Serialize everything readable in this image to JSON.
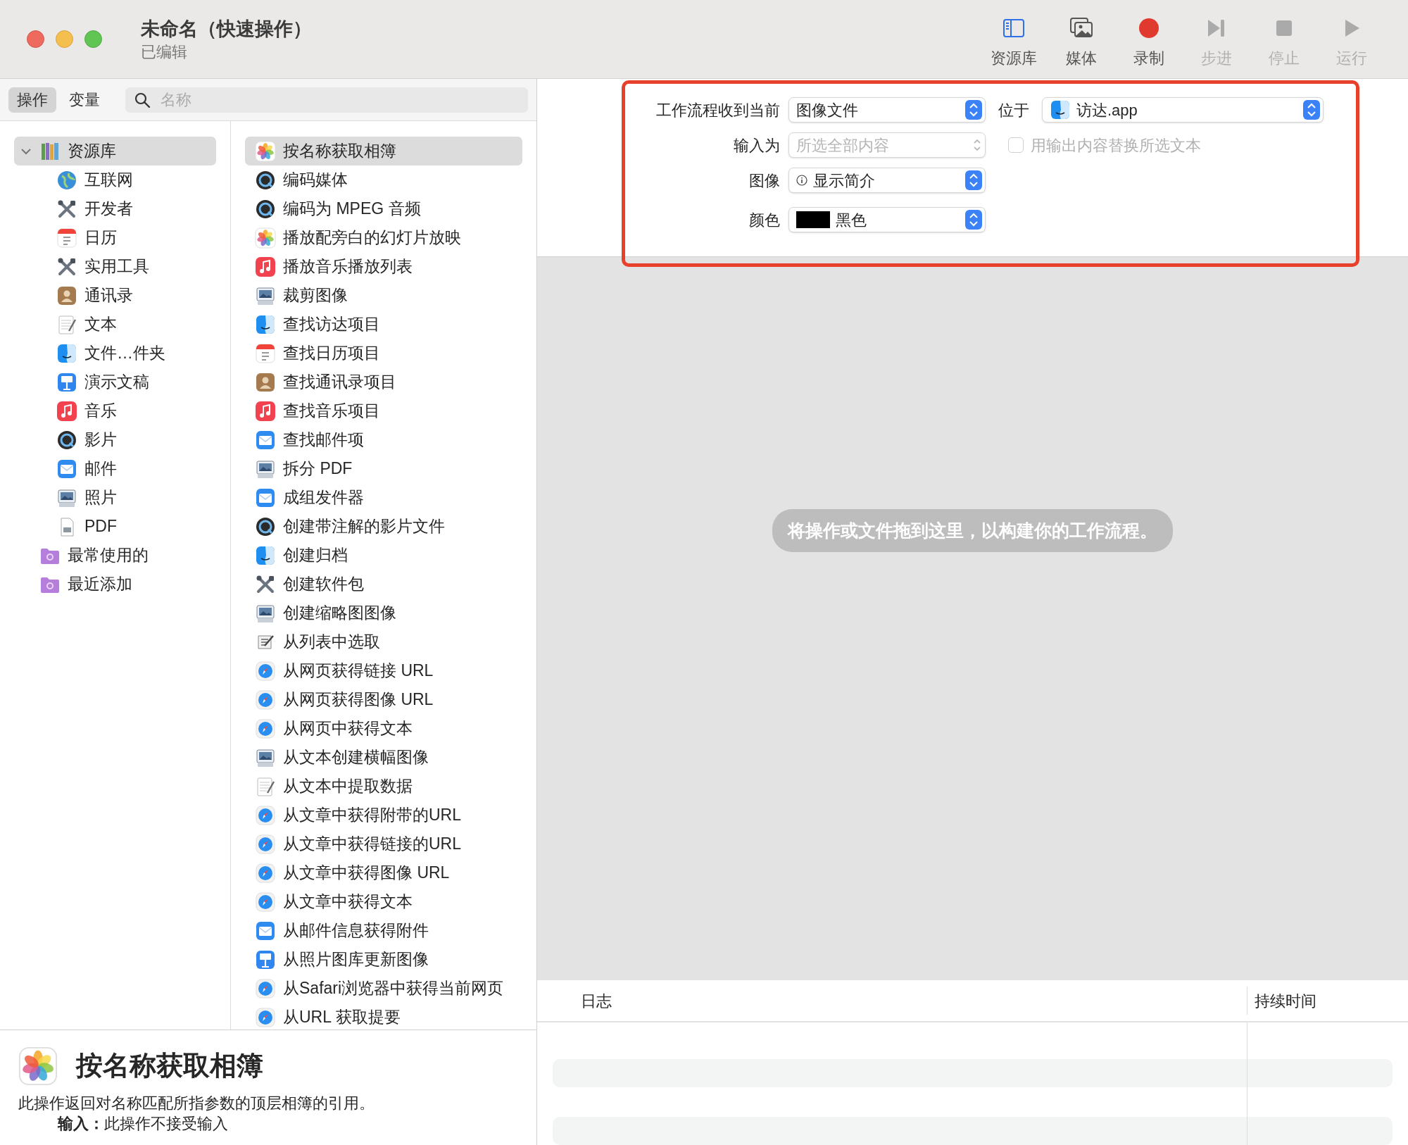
{
  "window": {
    "title": "未命名（快速操作）",
    "subtitle": "已编辑"
  },
  "toolbar": [
    {
      "label": "资源库",
      "kind": "library",
      "selected": true,
      "disabled": false
    },
    {
      "label": "媒体",
      "kind": "media",
      "selected": false,
      "disabled": false
    },
    {
      "label": "录制",
      "kind": "record",
      "disabled": false
    },
    {
      "label": "步进",
      "kind": "step",
      "disabled": true
    },
    {
      "label": "停止",
      "kind": "stop",
      "disabled": true
    },
    {
      "label": "运行",
      "kind": "run",
      "disabled": true
    }
  ],
  "library_tabs": [
    {
      "label": "操作",
      "selected": true
    },
    {
      "label": "变量",
      "selected": false
    }
  ],
  "search": {
    "placeholder": "名称"
  },
  "categories": [
    {
      "label": "资源库",
      "kind": "library",
      "expanded": true,
      "selected": true,
      "children": [
        {
          "label": "互联网",
          "kind": "globe",
          "selected": false
        },
        {
          "label": "开发者",
          "kind": "tools",
          "selected": false
        },
        {
          "label": "日历",
          "kind": "calendar",
          "selected": false
        },
        {
          "label": "实用工具",
          "kind": "tools",
          "selected": false
        },
        {
          "label": "通讯录",
          "kind": "contacts",
          "selected": false
        },
        {
          "label": "文本",
          "kind": "textedit",
          "selected": false
        },
        {
          "label": "文件…件夹",
          "kind": "finder",
          "selected": false
        },
        {
          "label": "演示文稿",
          "kind": "keynote",
          "selected": false
        },
        {
          "label": "音乐",
          "kind": "music",
          "selected": false
        },
        {
          "label": "影片",
          "kind": "quicktime",
          "selected": false
        },
        {
          "label": "邮件",
          "kind": "mail",
          "selected": false
        },
        {
          "label": "照片",
          "kind": "preview",
          "selected": false
        },
        {
          "label": "PDF",
          "kind": "pdf",
          "selected": false
        }
      ]
    },
    {
      "label": "最常使用的",
      "kind": "folder",
      "selected": false
    },
    {
      "label": "最近添加",
      "kind": "folder",
      "selected": false
    }
  ],
  "actions": [
    {
      "label": "按名称获取相簿",
      "kind": "photos",
      "selected": true
    },
    {
      "label": "编码媒体",
      "kind": "quicktime",
      "selected": false
    },
    {
      "label": "编码为 MPEG 音频",
      "kind": "quicktime",
      "selected": false
    },
    {
      "label": "播放配旁白的幻灯片放映",
      "kind": "photos",
      "selected": false
    },
    {
      "label": "播放音乐播放列表",
      "kind": "music",
      "selected": false
    },
    {
      "label": "裁剪图像",
      "kind": "preview",
      "selected": false
    },
    {
      "label": "查找访达项目",
      "kind": "finder",
      "selected": false
    },
    {
      "label": "查找日历项目",
      "kind": "calendar",
      "selected": false
    },
    {
      "label": "查找通讯录项目",
      "kind": "contacts",
      "selected": false
    },
    {
      "label": "查找音乐项目",
      "kind": "music",
      "selected": false
    },
    {
      "label": "查找邮件项",
      "kind": "mail",
      "selected": false
    },
    {
      "label": "拆分 PDF",
      "kind": "preview",
      "selected": false
    },
    {
      "label": "成组发件器",
      "kind": "mail",
      "selected": false
    },
    {
      "label": "创建带注解的影片文件",
      "kind": "quicktime",
      "selected": false
    },
    {
      "label": "创建归档",
      "kind": "finder",
      "selected": false
    },
    {
      "label": "创建软件包",
      "kind": "tools",
      "selected": false
    },
    {
      "label": "创建缩略图图像",
      "kind": "preview",
      "selected": false
    },
    {
      "label": "从列表中选取",
      "kind": "script",
      "selected": false
    },
    {
      "label": "从网页获得链接 URL",
      "kind": "safari",
      "selected": false
    },
    {
      "label": "从网页获得图像 URL",
      "kind": "safari",
      "selected": false
    },
    {
      "label": "从网页中获得文本",
      "kind": "safari",
      "selected": false
    },
    {
      "label": "从文本创建横幅图像",
      "kind": "preview",
      "selected": false
    },
    {
      "label": "从文本中提取数据",
      "kind": "textedit",
      "selected": false
    },
    {
      "label": "从文章中获得附带的URL",
      "kind": "safari",
      "selected": false
    },
    {
      "label": "从文章中获得链接的URL",
      "kind": "safari",
      "selected": false
    },
    {
      "label": "从文章中获得图像 URL",
      "kind": "safari",
      "selected": false
    },
    {
      "label": "从文章中获得文本",
      "kind": "safari",
      "selected": false
    },
    {
      "label": "从邮件信息获得附件",
      "kind": "mail",
      "selected": false
    },
    {
      "label": "从照片图库更新图像",
      "kind": "keynote",
      "selected": false
    },
    {
      "label": "从Safari浏览器中获得当前网页",
      "kind": "safari",
      "selected": false
    },
    {
      "label": "从URL 获取提要",
      "kind": "safari",
      "selected": false
    }
  ],
  "description": {
    "title": "按名称获取相簿",
    "kind": "photos",
    "text": "此操作返回对名称匹配所指参数的顶层相簿的引用。",
    "input": "**输入：**此操作不接受输入"
  },
  "workflow": {
    "receives": {
      "label": "工作流程收到当前",
      "value": "图像文件"
    },
    "location": {
      "label": "位于",
      "value": "访达.app",
      "kind": "finder"
    },
    "input": {
      "label": "输入为",
      "value": "所选全部内容",
      "disabled": true
    },
    "replace_checkbox": {
      "label": "用输出内容替换所选文本",
      "checked": false,
      "disabled": true
    },
    "image": {
      "label": "图像",
      "value": "显示简介"
    },
    "color": {
      "label": "颜色",
      "value": "黑色",
      "color": "#000000"
    }
  },
  "drop_hint": "将操作或文件拖到这里，以构建你的工作流程。",
  "log": {
    "columns": [
      "日志",
      "持续时间"
    ]
  }
}
